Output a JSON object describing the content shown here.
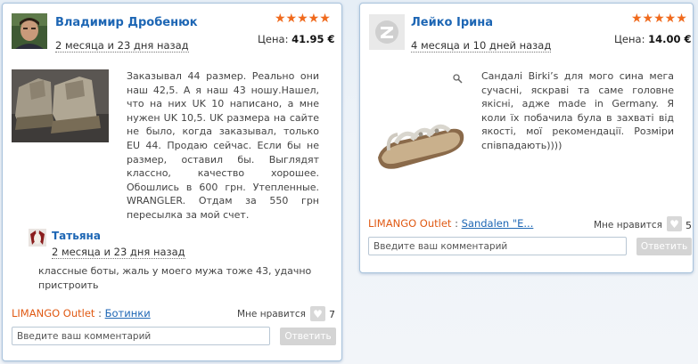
{
  "reviews": [
    {
      "user_name": "Владимир Дробенюк",
      "date": "2 месяца и 23 дня назад",
      "rating": 5,
      "stars": "★★★★★",
      "price_label": "Цена:",
      "price_value": "41.95 €",
      "text": "Заказывал 44 размер. Реально они наш 42,5. А я наш 43 ношу.Нашел, что на них UK 10 написано, а мне нужен UK 10,5. UK размера на сайте не было, когда заказывал, только EU 44. Продаю сейчас. Если бы не размер, оставил бы. Выглядят классно, качество хорошее. Обошлись в 600 грн. Утепленные. WRANGLER. Отдам за 550 грн пересылка за мой счет.",
      "comment": {
        "user_name": "Татьяна",
        "date": "2 месяца и 23 дня назад",
        "text": "классные боты, жаль у моего мужа тоже 43, удачно пристроить"
      },
      "store": "LIMANGO Outlet",
      "separator": " : ",
      "product_link": "Ботинки",
      "like_label": "Мне нравится",
      "like_count": "7",
      "comment_placeholder": "Введите ваш комментарий",
      "reply_label": "Ответить"
    },
    {
      "user_name": "Лейко Ірина",
      "date": "4 месяца и 10 дней назад",
      "rating": 5,
      "stars": "★★★★★",
      "price_label": "Цена:",
      "price_value": "14.00 €",
      "text": "Сандалі Birki’s для мого сина мега сучасні, яскраві та саме головне якісні, адже made in Germany. Я коли їх побачила була в захваті від якості, мої рекомендації. Розміри співпадають))))",
      "store": "LIMANGO Outlet",
      "separator": " : ",
      "product_link": "Sandalen \"E...",
      "like_label": "Мне нравится",
      "like_count": "5",
      "comment_placeholder": "Введите ваш комментарий",
      "reply_label": "Ответить"
    }
  ],
  "colors": {
    "link": "#1d66b4",
    "stars": "#f06a1d",
    "store": "#e05a14",
    "card_border": "#a9c3dc"
  },
  "icons": {
    "like": "heart-icon",
    "zoom": "magnifier-icon",
    "placeholder_avatar": "z-logo-icon"
  }
}
